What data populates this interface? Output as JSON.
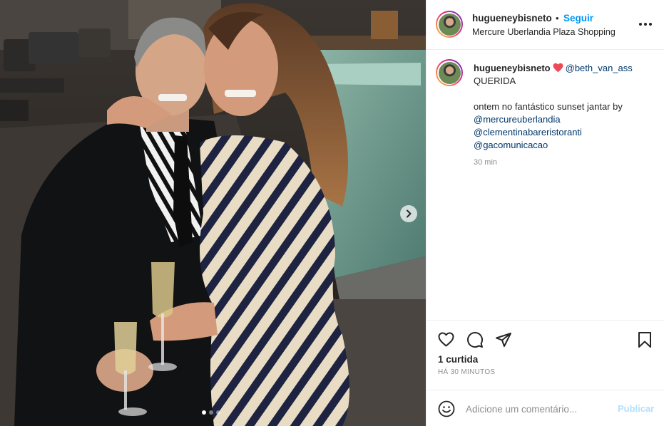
{
  "post": {
    "username": "hugueneybisneto",
    "separator": "•",
    "follow_label": "Seguir",
    "location": "Mercure Uberlandia Plaza Shopping",
    "image_alt": "Foto de um homem de terno preto e uma mulher de vestido listrado segurando taças de espumante à noite, ao lado de uma piscina",
    "carousel": {
      "slides_count": 3,
      "active_index": 0
    }
  },
  "caption": {
    "username": "hugueneybisneto",
    "tagged": "@beth_van_ass",
    "line1": "QUERIDA",
    "line2": "ontem no fantástico sunset jantar by",
    "mentions": [
      "@mercureuberlandia",
      "@clementinabareristoranti",
      "@gacomunicacao"
    ],
    "time": "30 min"
  },
  "engagement": {
    "likes": "1 curtida",
    "posted_ago": "HÁ 30 MINUTOS"
  },
  "comment": {
    "placeholder": "Adicione um comentário...",
    "post_label": "Publicar"
  },
  "colors": {
    "link_blue": "#0095f6",
    "mention_blue": "#00376b",
    "muted_gray": "#8e8e8e",
    "heart_red": "#ed4956",
    "publish_disabled": "#b2dffc"
  },
  "icons": {
    "like": "heart-outline-icon",
    "comment": "comment-bubble-icon",
    "share": "paper-plane-icon",
    "save": "bookmark-icon",
    "emoji": "smiley-icon",
    "next": "chevron-right-icon",
    "more": "more-options-icon"
  }
}
